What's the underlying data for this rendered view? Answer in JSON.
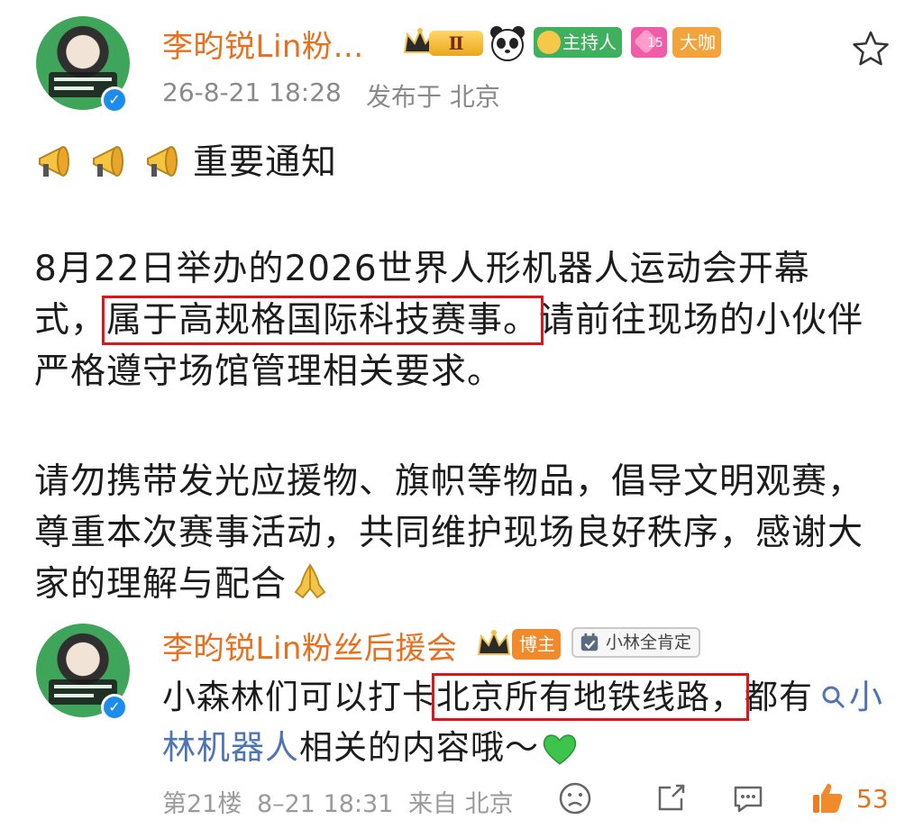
{
  "post": {
    "author": "李昀锐Lin粉…",
    "level": "Ⅱ",
    "badges": [
      {
        "label": "主持人",
        "color": "#3fb05d"
      },
      {
        "label": "15",
        "color": "#ef5da8"
      },
      {
        "label": "大咖",
        "color": "#f3a33b"
      }
    ],
    "timestamp": "26-8-21 18:28",
    "location": "发布于 北京",
    "icons": [
      "megaphone-icon",
      "megaphone-icon",
      "megaphone-icon"
    ],
    "heading": "重要通知",
    "para1_line1": "8月22日举办的2026世界人形机器人运动会开幕",
    "para1_line2_a": "式，",
    "para1_line2_hl": "属于高规格国际科技赛事。",
    "para1_line2_b": "请前往现场的小伙伴",
    "para1_line3": "严格遵守场馆管理相关要求。",
    "para2_line1": "请勿携带发光应援物、旗帜等物品，倡导文明观赛，",
    "para2_line2": "尊重本次赛事活动，共同维护现场良好秩序，感谢大",
    "para2_line3": "家的理解与配合"
  },
  "reply": {
    "author": "李昀锐Lin粉丝后援会",
    "badge_blogger": "博主",
    "tag": "小林全肯定",
    "line1_a": "小森林们可以打卡",
    "line1_hl": "北京所有地铁线路，",
    "line1_b": "都有",
    "line1_link": "小",
    "line2_link": "林机器人",
    "line2_b": "相关的内容哦～",
    "floor": "第21楼",
    "time": "8–21 18:31",
    "from": "来自 北京",
    "likes": "53"
  },
  "colors": {
    "accent": "#e8701d",
    "highlight": "#e0151c",
    "link": "#4f74b5"
  }
}
